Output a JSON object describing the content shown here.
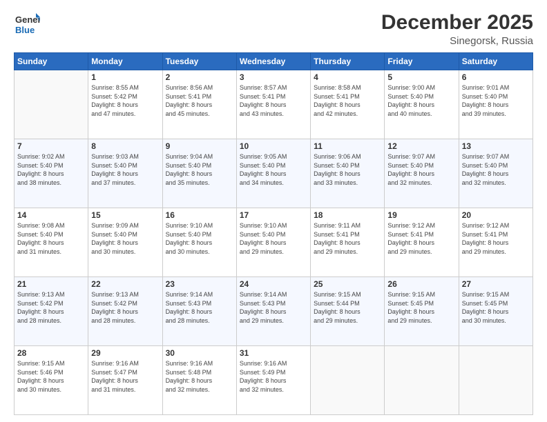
{
  "logo": {
    "line1": "General",
    "line2": "Blue"
  },
  "title": "December 2025",
  "subtitle": "Sinegorsk, Russia",
  "days_header": [
    "Sunday",
    "Monday",
    "Tuesday",
    "Wednesday",
    "Thursday",
    "Friday",
    "Saturday"
  ],
  "weeks": [
    [
      {
        "num": "",
        "info": ""
      },
      {
        "num": "1",
        "info": "Sunrise: 8:55 AM\nSunset: 5:42 PM\nDaylight: 8 hours\nand 47 minutes."
      },
      {
        "num": "2",
        "info": "Sunrise: 8:56 AM\nSunset: 5:41 PM\nDaylight: 8 hours\nand 45 minutes."
      },
      {
        "num": "3",
        "info": "Sunrise: 8:57 AM\nSunset: 5:41 PM\nDaylight: 8 hours\nand 43 minutes."
      },
      {
        "num": "4",
        "info": "Sunrise: 8:58 AM\nSunset: 5:41 PM\nDaylight: 8 hours\nand 42 minutes."
      },
      {
        "num": "5",
        "info": "Sunrise: 9:00 AM\nSunset: 5:40 PM\nDaylight: 8 hours\nand 40 minutes."
      },
      {
        "num": "6",
        "info": "Sunrise: 9:01 AM\nSunset: 5:40 PM\nDaylight: 8 hours\nand 39 minutes."
      }
    ],
    [
      {
        "num": "7",
        "info": "Sunrise: 9:02 AM\nSunset: 5:40 PM\nDaylight: 8 hours\nand 38 minutes."
      },
      {
        "num": "8",
        "info": "Sunrise: 9:03 AM\nSunset: 5:40 PM\nDaylight: 8 hours\nand 37 minutes."
      },
      {
        "num": "9",
        "info": "Sunrise: 9:04 AM\nSunset: 5:40 PM\nDaylight: 8 hours\nand 35 minutes."
      },
      {
        "num": "10",
        "info": "Sunrise: 9:05 AM\nSunset: 5:40 PM\nDaylight: 8 hours\nand 34 minutes."
      },
      {
        "num": "11",
        "info": "Sunrise: 9:06 AM\nSunset: 5:40 PM\nDaylight: 8 hours\nand 33 minutes."
      },
      {
        "num": "12",
        "info": "Sunrise: 9:07 AM\nSunset: 5:40 PM\nDaylight: 8 hours\nand 32 minutes."
      },
      {
        "num": "13",
        "info": "Sunrise: 9:07 AM\nSunset: 5:40 PM\nDaylight: 8 hours\nand 32 minutes."
      }
    ],
    [
      {
        "num": "14",
        "info": "Sunrise: 9:08 AM\nSunset: 5:40 PM\nDaylight: 8 hours\nand 31 minutes."
      },
      {
        "num": "15",
        "info": "Sunrise: 9:09 AM\nSunset: 5:40 PM\nDaylight: 8 hours\nand 30 minutes."
      },
      {
        "num": "16",
        "info": "Sunrise: 9:10 AM\nSunset: 5:40 PM\nDaylight: 8 hours\nand 30 minutes."
      },
      {
        "num": "17",
        "info": "Sunrise: 9:10 AM\nSunset: 5:40 PM\nDaylight: 8 hours\nand 29 minutes."
      },
      {
        "num": "18",
        "info": "Sunrise: 9:11 AM\nSunset: 5:41 PM\nDaylight: 8 hours\nand 29 minutes."
      },
      {
        "num": "19",
        "info": "Sunrise: 9:12 AM\nSunset: 5:41 PM\nDaylight: 8 hours\nand 29 minutes."
      },
      {
        "num": "20",
        "info": "Sunrise: 9:12 AM\nSunset: 5:41 PM\nDaylight: 8 hours\nand 29 minutes."
      }
    ],
    [
      {
        "num": "21",
        "info": "Sunrise: 9:13 AM\nSunset: 5:42 PM\nDaylight: 8 hours\nand 28 minutes."
      },
      {
        "num": "22",
        "info": "Sunrise: 9:13 AM\nSunset: 5:42 PM\nDaylight: 8 hours\nand 28 minutes."
      },
      {
        "num": "23",
        "info": "Sunrise: 9:14 AM\nSunset: 5:43 PM\nDaylight: 8 hours\nand 28 minutes."
      },
      {
        "num": "24",
        "info": "Sunrise: 9:14 AM\nSunset: 5:43 PM\nDaylight: 8 hours\nand 29 minutes."
      },
      {
        "num": "25",
        "info": "Sunrise: 9:15 AM\nSunset: 5:44 PM\nDaylight: 8 hours\nand 29 minutes."
      },
      {
        "num": "26",
        "info": "Sunrise: 9:15 AM\nSunset: 5:45 PM\nDaylight: 8 hours\nand 29 minutes."
      },
      {
        "num": "27",
        "info": "Sunrise: 9:15 AM\nSunset: 5:45 PM\nDaylight: 8 hours\nand 30 minutes."
      }
    ],
    [
      {
        "num": "28",
        "info": "Sunrise: 9:15 AM\nSunset: 5:46 PM\nDaylight: 8 hours\nand 30 minutes."
      },
      {
        "num": "29",
        "info": "Sunrise: 9:16 AM\nSunset: 5:47 PM\nDaylight: 8 hours\nand 31 minutes."
      },
      {
        "num": "30",
        "info": "Sunrise: 9:16 AM\nSunset: 5:48 PM\nDaylight: 8 hours\nand 32 minutes."
      },
      {
        "num": "31",
        "info": "Sunrise: 9:16 AM\nSunset: 5:49 PM\nDaylight: 8 hours\nand 32 minutes."
      },
      {
        "num": "",
        "info": ""
      },
      {
        "num": "",
        "info": ""
      },
      {
        "num": "",
        "info": ""
      }
    ]
  ]
}
